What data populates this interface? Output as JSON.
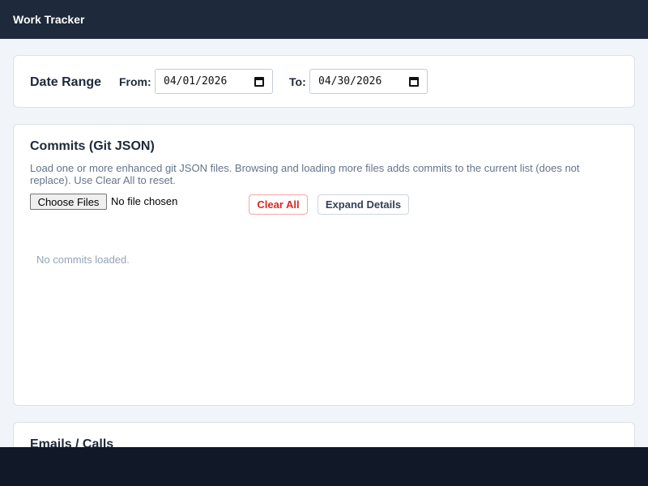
{
  "app": {
    "title": "Work Tracker"
  },
  "date_range": {
    "title": "Date Range",
    "from_label": "From:",
    "from_value": "04/01/2026",
    "to_label": "To:",
    "to_value": "04/30/2026"
  },
  "commits": {
    "title": "Commits (Git JSON)",
    "description": "Load one or more enhanced git JSON files. Browsing and loading more files adds commits to the current list (does not replace). Use Clear All to reset.",
    "choose_files_label": "Choose Files",
    "file_status": "No file chosen",
    "clear_all_label": "Clear All",
    "expand_details_label": "Expand Details",
    "empty_message": "No commits loaded."
  },
  "emails": {
    "title": "Emails / Calls"
  },
  "colors": {
    "header_bg": "#1e293b",
    "footer_bg": "#111827",
    "danger": "#dc2626",
    "muted": "#64748b"
  }
}
